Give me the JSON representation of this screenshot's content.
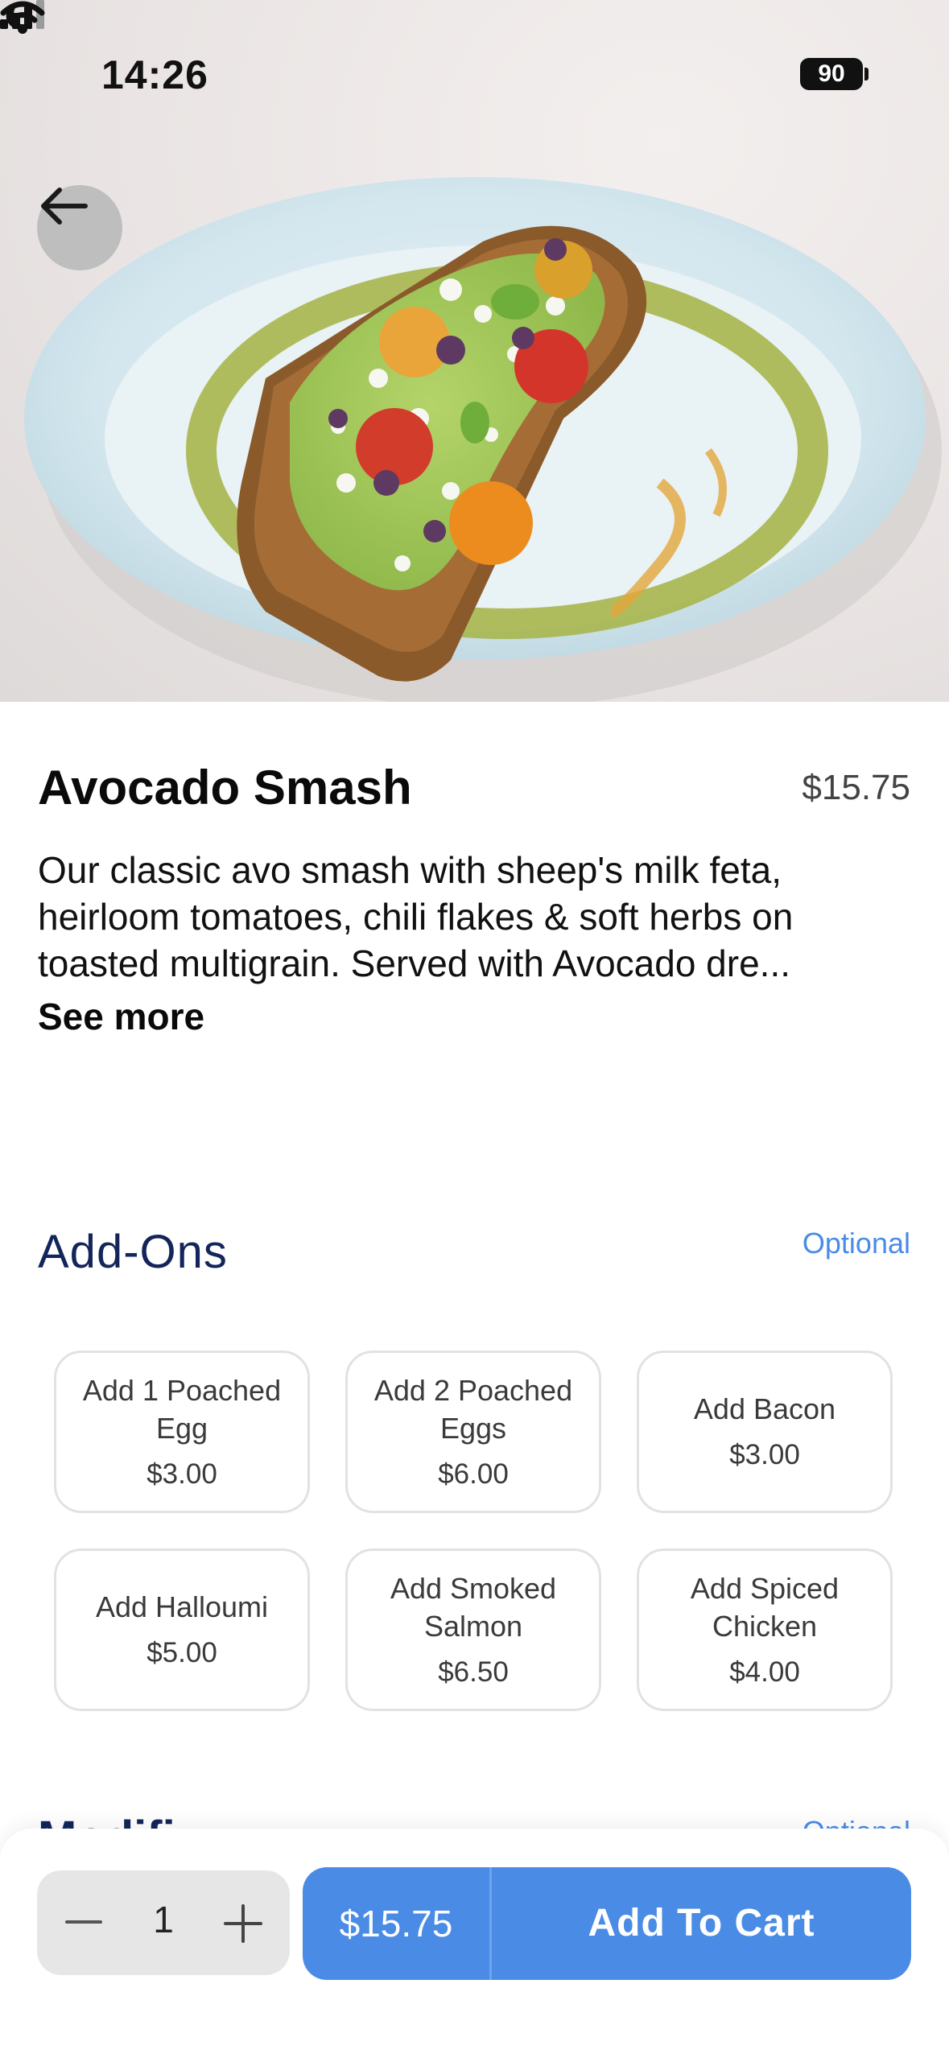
{
  "status_bar": {
    "time": "14:26",
    "battery": "90"
  },
  "product": {
    "name": "Avocado Smash",
    "price": "$15.75",
    "description": "Our classic avo smash with sheep's milk feta, heirloom tomatoes, chili flakes & soft herbs on toasted multigrain. Served with Avocado dre...",
    "see_more": "See more"
  },
  "addons": {
    "title": "Add-Ons",
    "optional": "Optional",
    "items": [
      {
        "name": "Add 1 Poached Egg",
        "price": "$3.00"
      },
      {
        "name": "Add 2 Poached Eggs",
        "price": "$6.00"
      },
      {
        "name": "Add Bacon",
        "price": "$3.00"
      },
      {
        "name": "Add Halloumi",
        "price": "$5.00"
      },
      {
        "name": "Add Smoked Salmon",
        "price": "$6.50"
      },
      {
        "name": "Add Spiced Chicken",
        "price": "$4.00"
      }
    ]
  },
  "next_section": {
    "title": "Modifi",
    "optional": "Optional"
  },
  "cart": {
    "quantity": "1",
    "price": "$15.75",
    "label": "Add To Cart"
  },
  "colors": {
    "accent": "#4a8be6",
    "heading": "#13255a"
  }
}
